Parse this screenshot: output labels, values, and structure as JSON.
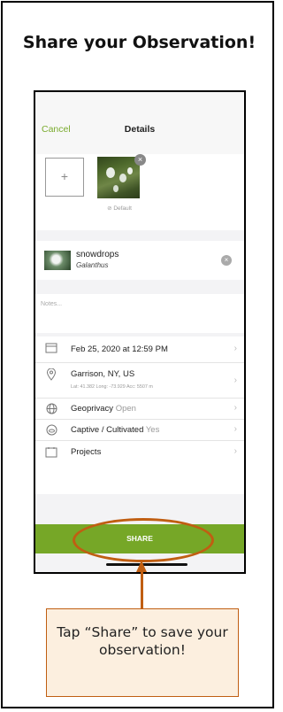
{
  "headline": "Share your Observation!",
  "nav": {
    "cancel_label": "Cancel",
    "title": "Details"
  },
  "photos": {
    "add_symbol": "+",
    "default_label": "⊘ Default",
    "remove_symbol": "×"
  },
  "taxon": {
    "common_name": "snowdrops",
    "scientific_name": "Galanthus",
    "clear_symbol": "×"
  },
  "notes": {
    "placeholder": "Notes..."
  },
  "rows": {
    "date": {
      "icon": "calendar-icon",
      "label": "Feb 25, 2020 at 12:59 PM"
    },
    "location": {
      "icon": "location-pin-icon",
      "label": "Garrison, NY, US",
      "coords": "Lat: 41.382  Long: -73.929  Acc: 5507 m"
    },
    "geoprivacy": {
      "icon": "globe-icon",
      "label": "Geoprivacy",
      "value": "Open"
    },
    "captive": {
      "icon": "captive-icon",
      "label": "Captive / Cultivated",
      "value": "Yes"
    },
    "projects": {
      "icon": "projects-icon",
      "label": "Projects"
    }
  },
  "share_button": "SHARE",
  "callout_text": "Tap “Share” to save your observation!",
  "colors": {
    "accent_green": "#76a727",
    "annotation_orange": "#c05e12",
    "callout_fill": "#fcefdf"
  }
}
